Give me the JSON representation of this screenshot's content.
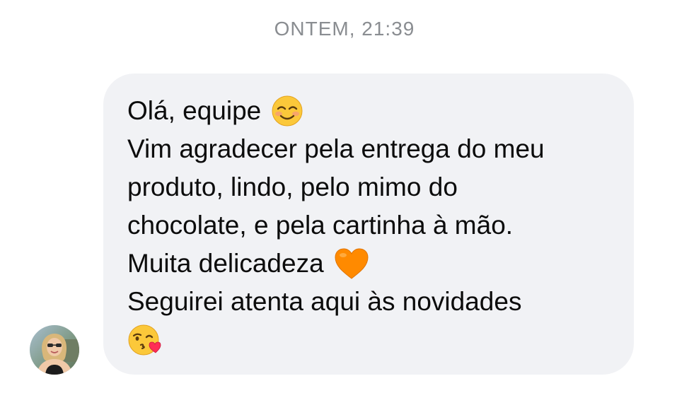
{
  "timestamp": "ONTEM, 21:39",
  "message": {
    "lines": [
      "Olá, equipe",
      "Vim agradecer pela entrega do meu",
      "produto, lindo, pelo mimo do",
      "chocolate, e pela cartinha à mão.",
      "Muita delicadeza",
      "Seguirei atenta aqui às novidades"
    ],
    "emojis": [
      "smiling-face-emoji",
      "orange-heart-emoji",
      "face-blowing-kiss-emoji"
    ]
  },
  "avatar": {
    "icon": "user-avatar-photo"
  },
  "colors": {
    "bubble_background": "#f1f2f5",
    "timestamp_text": "#8a8d91",
    "message_text": "#0c0c0c",
    "heart": "#ff8a00"
  }
}
